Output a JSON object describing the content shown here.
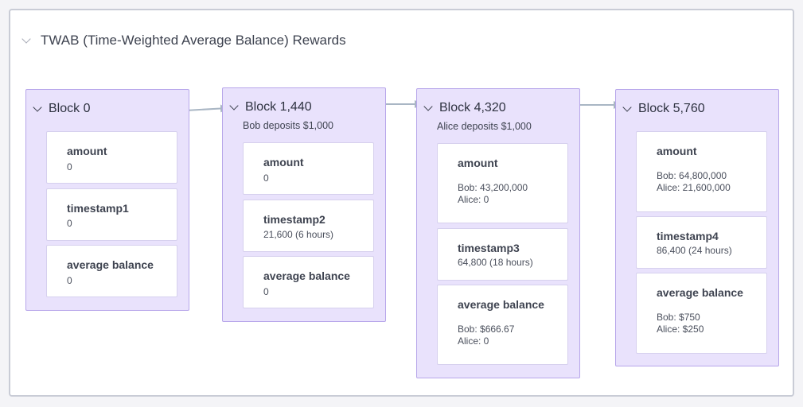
{
  "title": "TWAB (Time-Weighted Average Balance) Rewards",
  "blocks": [
    {
      "title": "Block 0",
      "subtitle": "",
      "cards": [
        {
          "label": "amount",
          "lines": [
            "0"
          ]
        },
        {
          "label": "timestamp1",
          "lines": [
            "0"
          ]
        },
        {
          "label": "average balance",
          "lines": [
            "0"
          ]
        }
      ]
    },
    {
      "title": "Block 1,440",
      "subtitle": "Bob deposits $1,000",
      "cards": [
        {
          "label": "amount",
          "lines": [
            "0"
          ]
        },
        {
          "label": "timestamp2",
          "lines": [
            "21,600 (6 hours)"
          ]
        },
        {
          "label": "average balance",
          "lines": [
            "0"
          ]
        }
      ]
    },
    {
      "title": "Block 4,320",
      "subtitle": "Alice deposits $1,000",
      "cards": [
        {
          "label": "amount",
          "lines": [
            "Bob: 43,200,000",
            "Alice: 0"
          ]
        },
        {
          "label": "timestamp3",
          "lines": [
            "64,800 (18 hours)"
          ]
        },
        {
          "label": "average balance",
          "lines": [
            "Bob: $666.67",
            "Alice: 0"
          ]
        }
      ]
    },
    {
      "title": "Block 5,760",
      "subtitle": "",
      "cards": [
        {
          "label": "amount",
          "lines": [
            "Bob: 64,800,000",
            "Alice: 21,600,000"
          ]
        },
        {
          "label": "timestamp4",
          "lines": [
            "86,400 (24 hours)"
          ]
        },
        {
          "label": "average balance",
          "lines": [
            "Bob: $750",
            "Alice: $250"
          ]
        }
      ]
    }
  ],
  "colors": {
    "block_fill": "#e9e2fc",
    "block_border": "#b7a6ea",
    "arrow": "#a9b6c4"
  }
}
